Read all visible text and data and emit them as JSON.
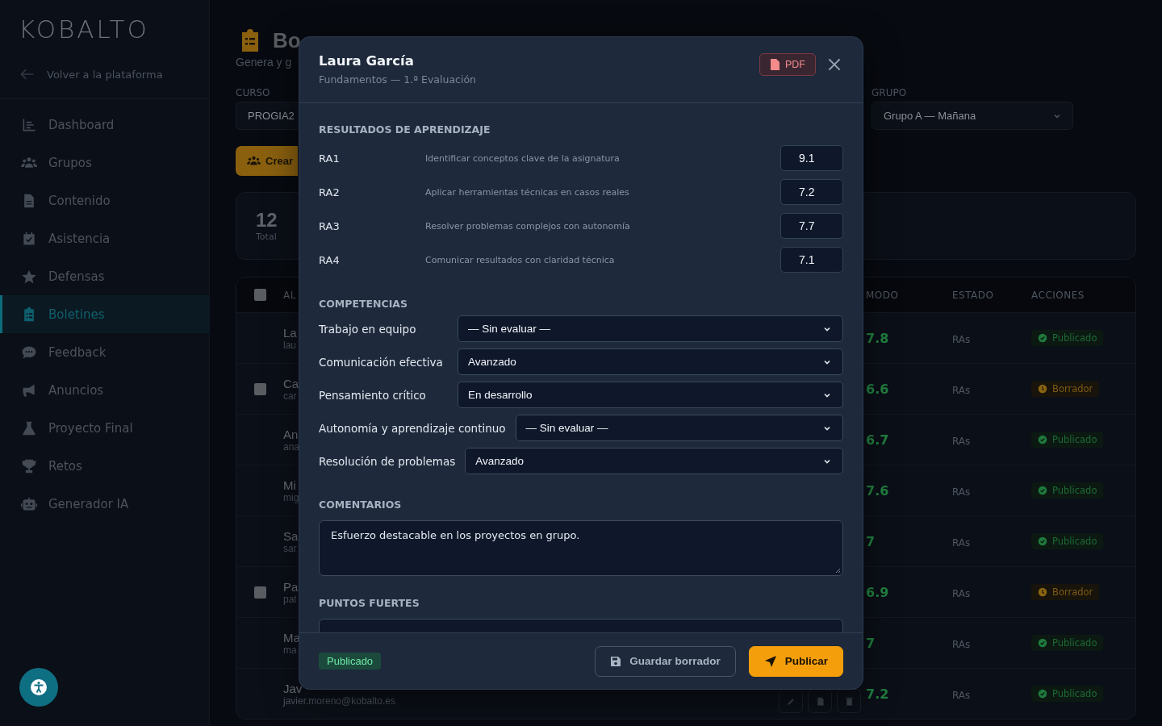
{
  "sidebar": {
    "logo": "KOBALTO",
    "back_link": "Volver a la plataforma",
    "items": [
      {
        "label": "Dashboard",
        "selected": false
      },
      {
        "label": "Grupos",
        "selected": false
      },
      {
        "label": "Contenido",
        "selected": false
      },
      {
        "label": "Asistencia",
        "selected": false
      },
      {
        "label": "Defensas",
        "selected": false
      },
      {
        "label": "Boletines",
        "selected": true
      },
      {
        "label": "Feedback",
        "selected": false
      },
      {
        "label": "Anuncios",
        "selected": false
      },
      {
        "label": "Proyecto Final",
        "selected": false
      },
      {
        "label": "Retos",
        "selected": false
      },
      {
        "label": "Generador IA",
        "selected": false
      }
    ]
  },
  "page": {
    "title": "Bo",
    "subtitle": "Genera y g",
    "filters": [
      {
        "label": "CURSO",
        "value": "PROGIA2"
      },
      {
        "label": "GRUPO",
        "value": "Grupo A — Mañana"
      }
    ],
    "create_button": "Crear",
    "stats": [
      {
        "value": "12",
        "label": "Total"
      }
    ]
  },
  "table": {
    "columns": [
      "AL",
      "MODO",
      "ESTADO",
      "ACCIONES"
    ],
    "header_checkbox": true,
    "rows": [
      {
        "name": "La",
        "email": "lau",
        "checkbox": false,
        "grade": "7.8",
        "ras": "RAs",
        "status": {
          "label": "Publicado",
          "kind": "published",
          "color": "#1f7a3d"
        }
      },
      {
        "name": "Ca",
        "email": "car",
        "checkbox": true,
        "grade": "6.6",
        "ras": "RAs",
        "status": {
          "label": "Borrador",
          "kind": "draft",
          "color": "#8a6411"
        }
      },
      {
        "name": "An",
        "email": "ana",
        "checkbox": false,
        "grade": "6.7",
        "ras": "RAs",
        "status": {
          "label": "Publicado",
          "kind": "published",
          "color": "#1f7a3d"
        }
      },
      {
        "name": "Mi",
        "email": "mig",
        "checkbox": false,
        "grade": "7.6",
        "ras": "RAs",
        "status": {
          "label": "Publicado",
          "kind": "published",
          "color": "#1f7a3d"
        }
      },
      {
        "name": "Sa",
        "email": "sar",
        "checkbox": false,
        "grade": "7",
        "ras": "RAs",
        "status": {
          "label": "Publicado",
          "kind": "published",
          "color": "#1f7a3d"
        }
      },
      {
        "name": "Pa",
        "email": "pat",
        "checkbox": true,
        "grade": "6.9",
        "ras": "RAs",
        "status": {
          "label": "Borrador",
          "kind": "draft",
          "color": "#8a6411"
        }
      },
      {
        "name": "Ma",
        "email": "ma",
        "checkbox": false,
        "grade": "7",
        "ras": "RAs",
        "status": {
          "label": "Publicado",
          "kind": "published",
          "color": "#1f7a3d"
        }
      },
      {
        "name": "Jav",
        "email": "javier.moreno@kobalto.es",
        "checkbox": false,
        "grade": "7.2",
        "ras": "RAs",
        "status": {
          "label": "Publicado",
          "kind": "published",
          "color": "#1f7a3d"
        }
      }
    ]
  },
  "modal": {
    "title": "Laura García",
    "subtitle": "Fundamentos — 1.ª Evaluación",
    "pdf_button": "PDF",
    "sections": [
      {
        "kind": "outcomes",
        "title": "RESULTADOS DE APRENDIZAJE",
        "items": [
          {
            "code": "RA1",
            "description": "Identificar conceptos clave de la asignatura",
            "score": "9.1"
          },
          {
            "code": "RA2",
            "description": "Aplicar herramientas técnicas en casos reales",
            "score": "7.2"
          },
          {
            "code": "RA3",
            "description": "Resolver problemas complejos con autonomía",
            "score": "7.7"
          },
          {
            "code": "RA4",
            "description": "Comunicar resultados con claridad técnica",
            "score": "7.1"
          }
        ]
      },
      {
        "kind": "competencies",
        "title": "COMPETENCIAS",
        "items": [
          {
            "label": "Trabajo en equipo",
            "value": "— Sin evaluar —"
          },
          {
            "label": "Comunicación efectiva",
            "value": "Avanzado"
          },
          {
            "label": "Pensamiento crítico",
            "value": "En desarrollo"
          },
          {
            "label": "Autonomía y aprendizaje continuo",
            "value": "— Sin evaluar —"
          },
          {
            "label": "Resolución de problemas",
            "value": "Avanzado"
          }
        ]
      },
      {
        "kind": "text",
        "title": "COMENTARIOS",
        "value": "Esfuerzo destacable en los proyectos en grupo."
      },
      {
        "kind": "text",
        "title": "PUNTOS FUERTES"
      }
    ],
    "status": "Publicado",
    "buttons": [
      {
        "label": "Guardar borrador",
        "kind": "secondary"
      },
      {
        "label": "Publicar",
        "kind": "primary"
      }
    ]
  }
}
